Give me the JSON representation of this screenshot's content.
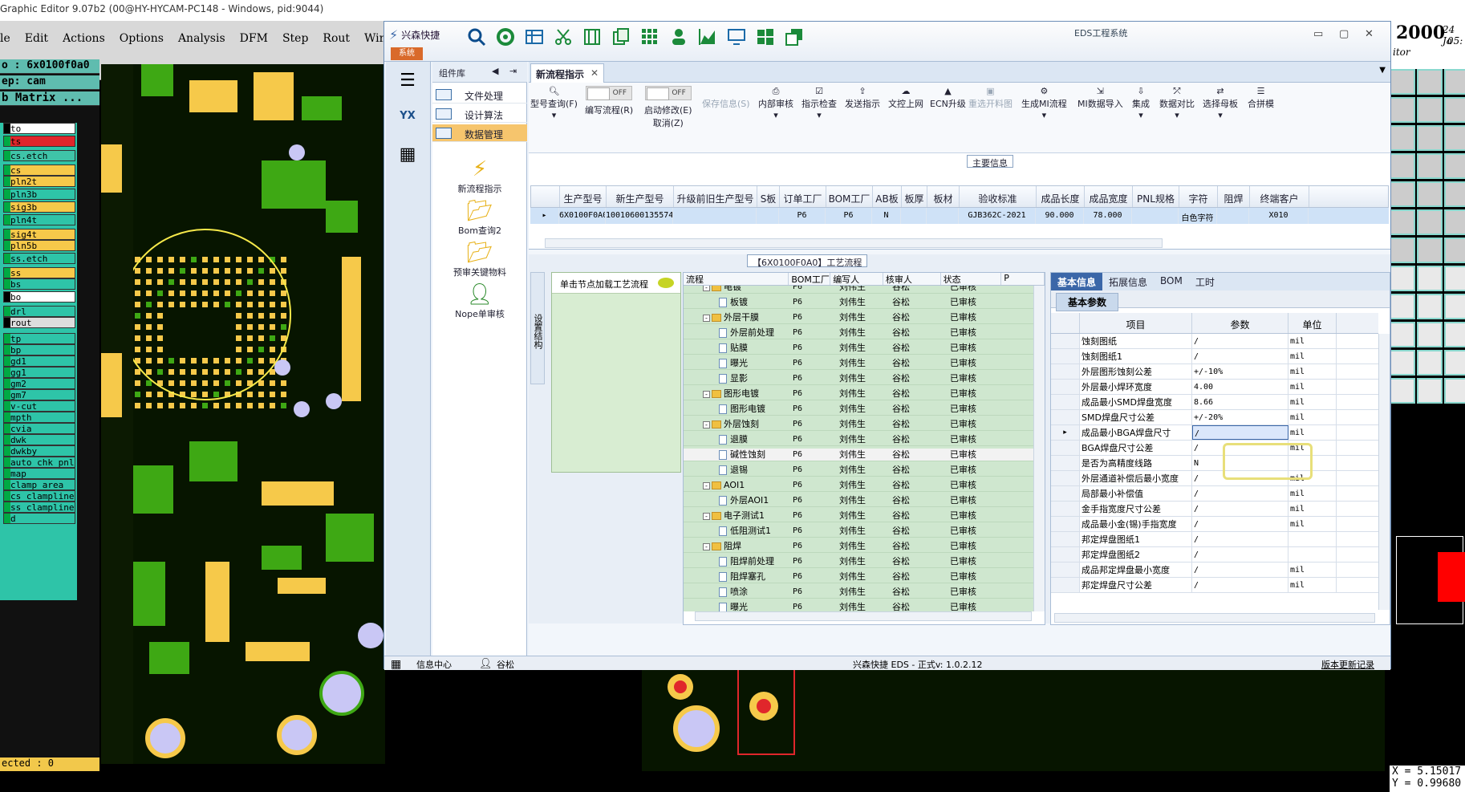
{
  "ge": {
    "title": "Graphic Editor 9.07b2 (00@HY-HYCAM-PC148 - Windows, pid:9044)",
    "menu": [
      "le",
      "Edit",
      "Actions",
      "Options",
      "Analysis",
      "DFM",
      "Step",
      "Rout",
      "Windows"
    ],
    "info1": "o : 6x0100f0a0",
    "info2": "ep: cam",
    "info3": "b Matrix ...",
    "status": "ected : 0",
    "layers": [
      {
        "name": "to",
        "color": "#ffffff"
      },
      {
        "name": "ts",
        "color": "#e0262b"
      },
      {
        "name": "cs.etch",
        "color": "#3fc4a8"
      },
      {
        "name": "cs",
        "color": "#f6c94a"
      },
      {
        "name": "pln2t",
        "color": "#f6c94a"
      },
      {
        "name": "pln3b",
        "color": "#2ec4a8"
      },
      {
        "name": "sig3b",
        "color": "#f6c94a"
      },
      {
        "name": "pln4t",
        "color": "#2ec4a8"
      },
      {
        "name": "sig4t",
        "color": "#f6c94a"
      },
      {
        "name": "pln5b",
        "color": "#f6c94a"
      },
      {
        "name": "ss.etch",
        "color": "#2ec4a8"
      },
      {
        "name": "ss",
        "color": "#f6c94a"
      },
      {
        "name": "bs",
        "color": "#2ec4a8"
      },
      {
        "name": "bo",
        "color": "#ffffff"
      },
      {
        "name": "drl",
        "color": "#2ec4a8"
      },
      {
        "name": "rout",
        "color": "#dddddd"
      },
      {
        "name": "tp",
        "color": "#2ec4a8"
      },
      {
        "name": "bp",
        "color": "#2ec4a8"
      },
      {
        "name": "gd1",
        "color": "#2ec4a8"
      },
      {
        "name": "gg1",
        "color": "#2ec4a8"
      },
      {
        "name": "gm2",
        "color": "#2ec4a8"
      },
      {
        "name": "gm7",
        "color": "#2ec4a8"
      },
      {
        "name": "v-cut",
        "color": "#2ec4a8"
      },
      {
        "name": "mpth",
        "color": "#2ec4a8"
      },
      {
        "name": "cvia",
        "color": "#2ec4a8"
      },
      {
        "name": "dwk",
        "color": "#2ec4a8"
      },
      {
        "name": "dwkby",
        "color": "#2ec4a8"
      },
      {
        "name": "auto_chk_pnl",
        "color": "#2ec4a8"
      },
      {
        "name": "map",
        "color": "#2ec4a8"
      },
      {
        "name": "clamp_area",
        "color": "#2ec4a8"
      },
      {
        "name": "cs_clampline",
        "color": "#2ec4a8"
      },
      {
        "name": "ss_clampline",
        "color": "#2ec4a8"
      },
      {
        "name": "d",
        "color": "#2ec4a8"
      }
    ],
    "right_head": "2000",
    "right_head2": "24 Ja",
    "right_head3": "05:",
    "right_head4": "itor",
    "coord_x": "X = 5.15017",
    "coord_y": "Y = 0.99680"
  },
  "eds": {
    "app_name": "兴森快捷",
    "system_label": "系统",
    "window_title": "EDS工程系统",
    "lib_title": "组件库",
    "lib_items": [
      "文件处理",
      "设计算法",
      "数据管理"
    ],
    "lib_tools": [
      "新流程指示",
      "Bom查询2",
      "预审关键物料",
      "Nope单审核"
    ],
    "tab_label": "新流程指示",
    "ribbon": {
      "r1": "型号查询(F)",
      "r2_toggle": "OFF",
      "r2": "编写流程(R)",
      "r3_toggle": "OFF",
      "r3": "启动修改(E)",
      "r3b": "取消(Z)",
      "r4": "保存信息(S)",
      "r5": "内部审核",
      "r6": "指示检查",
      "r7": "发送指示",
      "r8": "文控上网",
      "r9": "ECN升级",
      "r10": "重选开料图",
      "r11": "生成MI流程",
      "r12": "MI数据导入",
      "r13": "集成",
      "r14": "数据对比",
      "r15": "选择母板",
      "r16": "合拼模"
    },
    "main_info_title": "主要信息",
    "main_cols": [
      "生产型号",
      "新生产型号",
      "升级前旧生产型号",
      "S板",
      "订单工厂",
      "BOM工厂",
      "AB板",
      "板厚",
      "板材",
      "验收标准",
      "成品长度",
      "成品宽度",
      "PNL规格",
      "字符",
      "阻焊",
      "终端客户"
    ],
    "main_row": [
      "6X0100F0A0",
      "10010600135574",
      "",
      "",
      "P6",
      "P6",
      "N",
      "",
      "",
      "GJB362C-2021",
      "90.000",
      "78.000",
      "",
      "白色字符",
      "",
      "X010"
    ],
    "process_title": "【6X0100F0A0】工艺流程",
    "side_label": "设置结构",
    "node_hint": "单击节点加载工艺流程",
    "proc_cols": [
      "流程",
      "BOM工厂",
      "编写人",
      "核审人",
      "状态",
      "P"
    ],
    "proc_rows": [
      {
        "name": "电镀",
        "lvl": 1,
        "type": "folder",
        "bom": "P6",
        "writer": "刘伟生",
        "reviewer": "谷松",
        "status": "已审核"
      },
      {
        "name": "板镀",
        "lvl": 2,
        "type": "doc",
        "bom": "P6",
        "writer": "刘伟生",
        "reviewer": "谷松",
        "status": "已审核"
      },
      {
        "name": "外层干膜",
        "lvl": 1,
        "type": "folder",
        "bom": "P6",
        "writer": "刘伟生",
        "reviewer": "谷松",
        "status": "已审核"
      },
      {
        "name": "外层前处理",
        "lvl": 2,
        "type": "doc",
        "bom": "P6",
        "writer": "刘伟生",
        "reviewer": "谷松",
        "status": "已审核"
      },
      {
        "name": "贴膜",
        "lvl": 2,
        "type": "doc",
        "bom": "P6",
        "writer": "刘伟生",
        "reviewer": "谷松",
        "status": "已审核"
      },
      {
        "name": "曝光",
        "lvl": 2,
        "type": "doc",
        "bom": "P6",
        "writer": "刘伟生",
        "reviewer": "谷松",
        "status": "已审核"
      },
      {
        "name": "显影",
        "lvl": 2,
        "type": "doc",
        "bom": "P6",
        "writer": "刘伟生",
        "reviewer": "谷松",
        "status": "已审核"
      },
      {
        "name": "图形电镀",
        "lvl": 1,
        "type": "folder",
        "bom": "P6",
        "writer": "刘伟生",
        "reviewer": "谷松",
        "status": "已审核"
      },
      {
        "name": "图形电镀",
        "lvl": 2,
        "type": "doc",
        "bom": "P6",
        "writer": "刘伟生",
        "reviewer": "谷松",
        "status": "已审核"
      },
      {
        "name": "外层蚀刻",
        "lvl": 1,
        "type": "folder",
        "bom": "P6",
        "writer": "刘伟生",
        "reviewer": "谷松",
        "status": "已审核"
      },
      {
        "name": "退膜",
        "lvl": 2,
        "type": "doc",
        "bom": "P6",
        "writer": "刘伟生",
        "reviewer": "谷松",
        "status": "已审核"
      },
      {
        "name": "碱性蚀刻",
        "lvl": 2,
        "type": "doc",
        "bom": "P6",
        "writer": "刘伟生",
        "reviewer": "谷松",
        "status": "已审核",
        "sel": true
      },
      {
        "name": "退锡",
        "lvl": 2,
        "type": "doc",
        "bom": "P6",
        "writer": "刘伟生",
        "reviewer": "谷松",
        "status": "已审核"
      },
      {
        "name": "AOI1",
        "lvl": 1,
        "type": "folder",
        "bom": "P6",
        "writer": "刘伟生",
        "reviewer": "谷松",
        "status": "已审核"
      },
      {
        "name": "外层AOI1",
        "lvl": 2,
        "type": "doc",
        "bom": "P6",
        "writer": "刘伟生",
        "reviewer": "谷松",
        "status": "已审核"
      },
      {
        "name": "电子测试1",
        "lvl": 1,
        "type": "folder",
        "bom": "P6",
        "writer": "刘伟生",
        "reviewer": "谷松",
        "status": "已审核"
      },
      {
        "name": "低阻测试1",
        "lvl": 2,
        "type": "doc",
        "bom": "P6",
        "writer": "刘伟生",
        "reviewer": "谷松",
        "status": "已审核"
      },
      {
        "name": "阻焊",
        "lvl": 1,
        "type": "folder",
        "bom": "P6",
        "writer": "刘伟生",
        "reviewer": "谷松",
        "status": "已审核"
      },
      {
        "name": "阻焊前处理",
        "lvl": 2,
        "type": "doc",
        "bom": "P6",
        "writer": "刘伟生",
        "reviewer": "谷松",
        "status": "已审核"
      },
      {
        "name": "阻焊塞孔",
        "lvl": 2,
        "type": "doc",
        "bom": "P6",
        "writer": "刘伟生",
        "reviewer": "谷松",
        "status": "已审核"
      },
      {
        "name": "喷涂",
        "lvl": 2,
        "type": "doc",
        "bom": "P6",
        "writer": "刘伟生",
        "reviewer": "谷松",
        "status": "已审核"
      },
      {
        "name": "曝光",
        "lvl": 2,
        "type": "doc",
        "bom": "P6",
        "writer": "刘伟生",
        "reviewer": "谷松",
        "status": "已审核"
      }
    ],
    "prop_tabs": [
      "基本信息",
      "拓展信息",
      "BOM",
      "工时"
    ],
    "prop_subtab": "基本参数",
    "prop_cols": [
      "项目",
      "参数",
      "单位"
    ],
    "prop_rows": [
      {
        "name": "蚀刻图纸",
        "value": "/",
        "unit": "mil"
      },
      {
        "name": "蚀刻图纸1",
        "value": "/",
        "unit": "mil"
      },
      {
        "name": "外层图形蚀刻公差",
        "value": "+/-10%",
        "unit": "mil"
      },
      {
        "name": "外层最小焊环宽度",
        "value": "4.00",
        "unit": "mil"
      },
      {
        "name": "成品最小SMD焊盘宽度",
        "value": "8.66",
        "unit": "mil"
      },
      {
        "name": "SMD焊盘尺寸公差",
        "value": "+/-20%",
        "unit": "mil"
      },
      {
        "name": "成品最小BGA焊盘尺寸",
        "value": "/",
        "unit": "mil",
        "sel": true
      },
      {
        "name": "BGA焊盘尺寸公差",
        "value": "/",
        "unit": "mil"
      },
      {
        "name": "是否为高精度线路",
        "value": "N",
        "unit": ""
      },
      {
        "name": "外层通道补偿后最小宽度",
        "value": "/",
        "unit": "mil"
      },
      {
        "name": "局部最小补偿值",
        "value": "/",
        "unit": "mil"
      },
      {
        "name": "金手指宽度尺寸公差",
        "value": "/",
        "unit": "mil"
      },
      {
        "name": "成品最小金(锡)手指宽度",
        "value": "/",
        "unit": "mil"
      },
      {
        "name": "邦定焊盘图纸1",
        "value": "/",
        "unit": ""
      },
      {
        "name": "邦定焊盘图纸2",
        "value": "/",
        "unit": ""
      },
      {
        "name": "成品邦定焊盘最小宽度",
        "value": "/",
        "unit": "mil"
      },
      {
        "name": "邦定焊盘尺寸公差",
        "value": "/",
        "unit": "mil"
      }
    ],
    "status_info": "信息中心",
    "status_user": "谷松",
    "status_version": "兴森快捷 EDS - 正式v: 1.0.2.12",
    "status_link": "版本更新记录"
  }
}
